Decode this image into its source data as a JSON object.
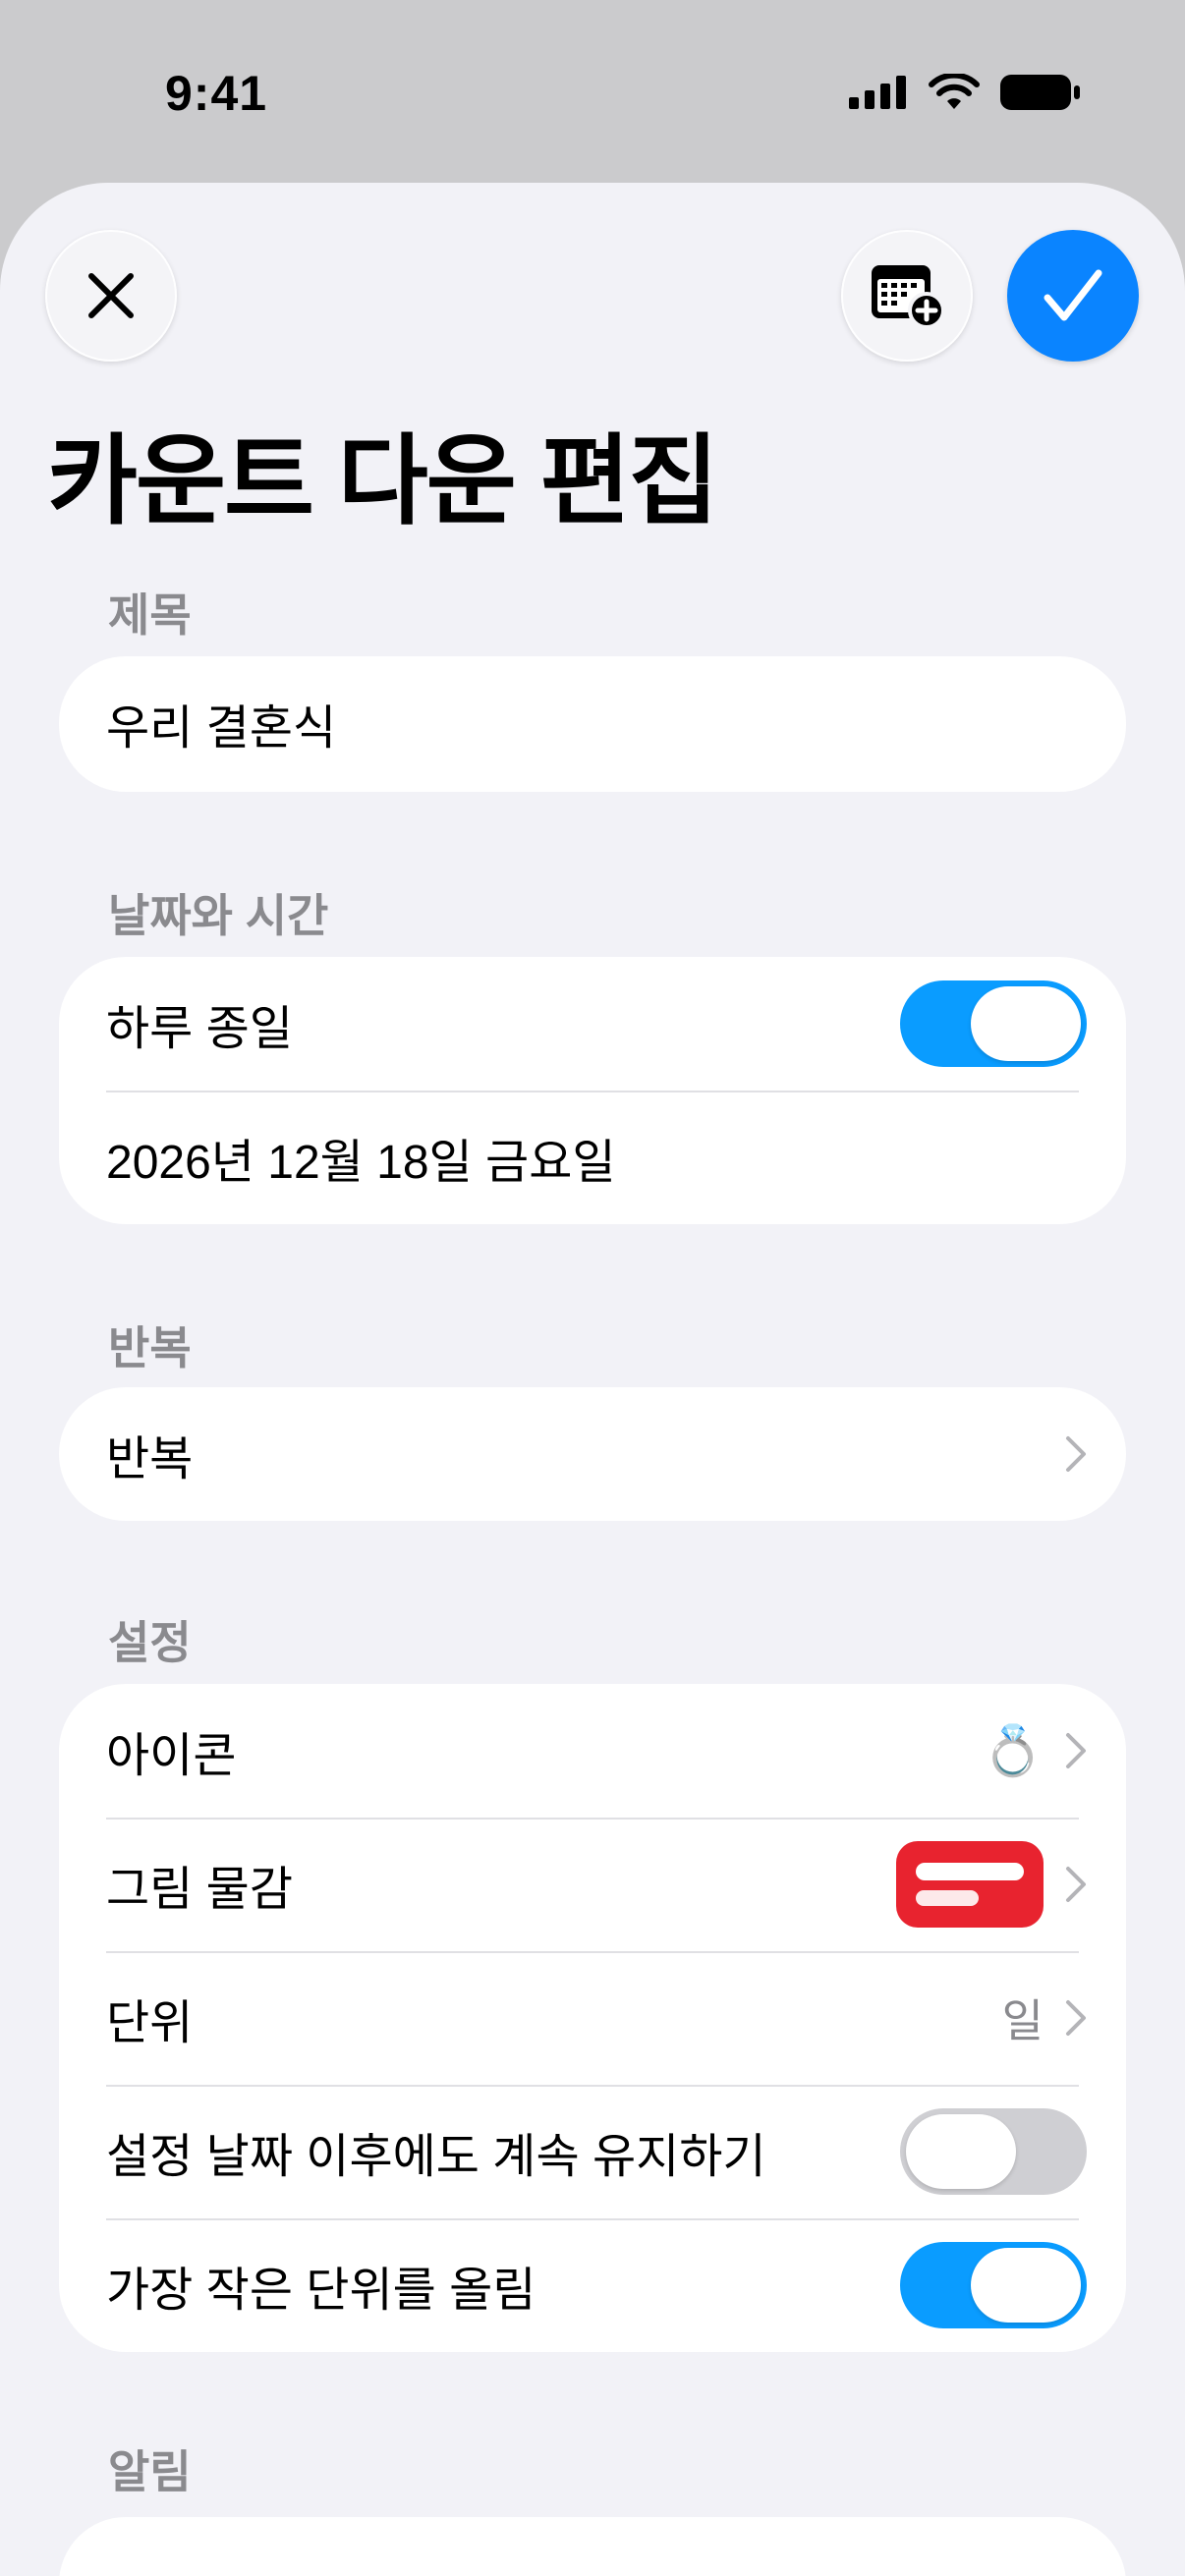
{
  "status_bar": {
    "time": "9:41"
  },
  "header": {
    "title": "카운트 다운 편집",
    "close_icon": "xmark-icon",
    "calendar_icon": "calendar-add-icon",
    "confirm_icon": "checkmark-icon"
  },
  "sections": {
    "title": {
      "label": "제목",
      "value": "우리 결혼식"
    },
    "datetime": {
      "label": "날짜와 시간",
      "all_day_label": "하루 종일",
      "all_day_on": true,
      "date_value": "2026년 12월 18일 금요일"
    },
    "repeat": {
      "label": "반복",
      "row_label": "반복"
    },
    "settings": {
      "label": "설정",
      "icon_label": "아이콘",
      "icon_value": "💍",
      "texture_label": "그림 물감",
      "texture_color": "#e8232f",
      "unit_label": "단위",
      "unit_value": "일",
      "keep_label": "설정 날짜 이후에도 계속 유지하기",
      "keep_on": false,
      "round_label": "가장 작은 단위를 올림",
      "round_on": true
    },
    "alerts": {
      "label": "알림"
    }
  },
  "colors": {
    "accent": "#0a84ff",
    "toggle_on": "#0a9cff",
    "background": "#f2f2f7"
  }
}
